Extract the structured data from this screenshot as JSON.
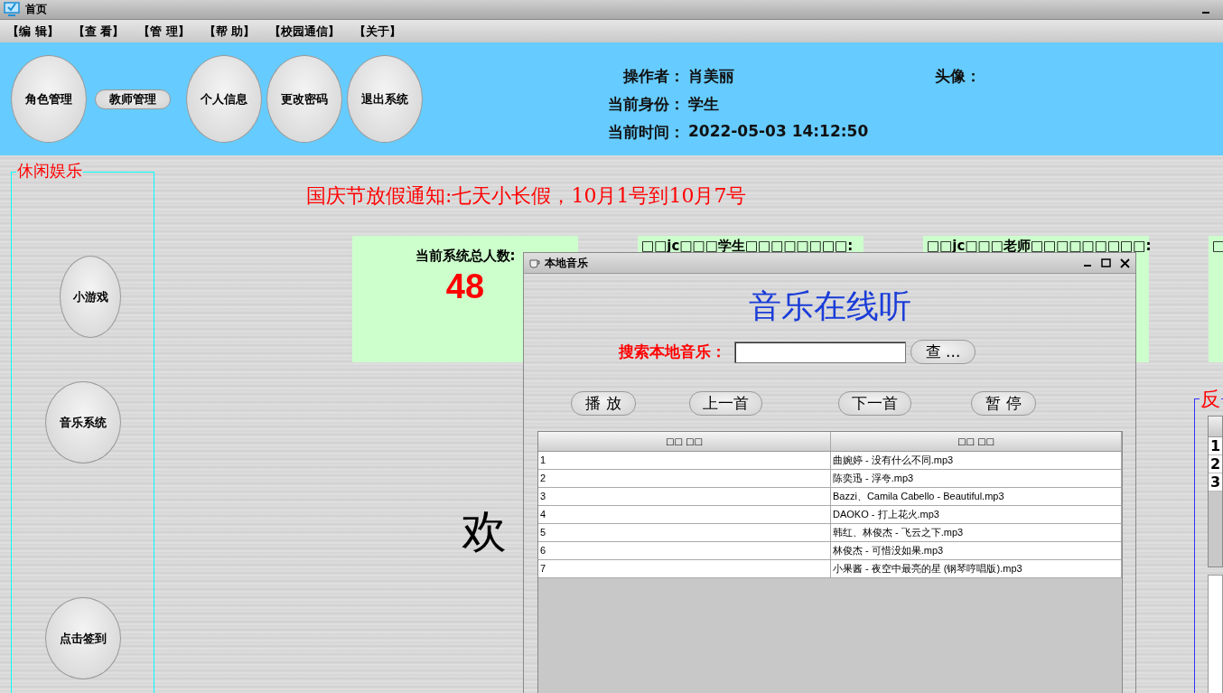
{
  "window": {
    "title": "首页"
  },
  "menu": [
    "【编 辑】",
    "【查 看】",
    "【管 理】",
    "【帮 助】",
    "【校园通信】",
    "【关于】"
  ],
  "toolbar": [
    {
      "label": "角色管理",
      "kind": "round"
    },
    {
      "label": "教师管理",
      "kind": "pill"
    },
    {
      "label": "个人信息",
      "kind": "round"
    },
    {
      "label": "更改密码",
      "kind": "round"
    },
    {
      "label": "退出系统",
      "kind": "round"
    }
  ],
  "user_info": [
    {
      "label": "操作者：",
      "value": "肖美丽"
    },
    {
      "label": "当前身份：",
      "value": "学生"
    },
    {
      "label": "当前时间：",
      "value": "2022-05-03 14:12:50"
    }
  ],
  "avatar": {
    "label": "头像："
  },
  "sidebar": {
    "title": "休闲娱乐",
    "buttons": [
      "小游戏",
      "音乐系统",
      "点击签到"
    ]
  },
  "notice": "国庆节放假通知:七天小长假，10月1号到10月7号",
  "stat_cards": [
    {
      "label": "当前系统总人数:",
      "value": "48"
    },
    {
      "label": "□□jc□□□学生□□□□□□□□:"
    },
    {
      "label": "□□jc□□□老师□□□□□□□□□:"
    },
    {
      "label": "□"
    }
  ],
  "welcome": "欢",
  "feedback_panel": {
    "title": "反",
    "rows": [
      "1",
      "2",
      "3"
    ]
  },
  "music_window": {
    "title": "本地音乐",
    "heading": "音乐在线听",
    "search": {
      "label": "搜索本地音乐：",
      "button": "查 ..."
    },
    "controls": [
      "播 放",
      "上一首",
      "下一首",
      "暂 停"
    ],
    "table": {
      "columns": [
        "□□ □□",
        "□□ □□"
      ],
      "rows": [
        [
          "1",
          "曲婉婷 - 没有什么不同.mp3"
        ],
        [
          "2",
          "陈奕迅 - 浮夸.mp3"
        ],
        [
          "3",
          "Bazzi、Camila Cabello - Beautiful.mp3"
        ],
        [
          "4",
          "DAOKO - 打上花火.mp3"
        ],
        [
          "5",
          "韩红、林俊杰 - 飞云之下.mp3"
        ],
        [
          "6",
          "林俊杰 - 可惜没如果.mp3"
        ],
        [
          "7",
          "小果酱 - 夜空中最亮的星 (钢琴哼唱版).mp3"
        ]
      ]
    }
  }
}
